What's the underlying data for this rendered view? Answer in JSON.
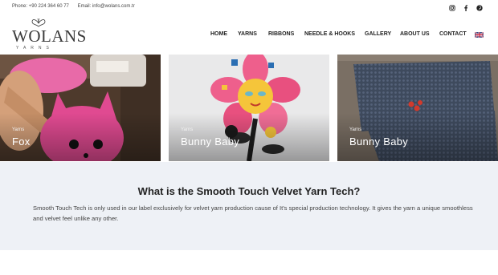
{
  "topbar": {
    "phone": "Phone: +90 224 364 60 77",
    "email": "Email: info@wolans.com.tr",
    "social": [
      "instagram-icon",
      "facebook-icon",
      "pinterest-icon"
    ]
  },
  "brand": {
    "name": "WOLANS",
    "tagline": "YARNS"
  },
  "nav": [
    "HOME",
    "YARNS",
    "RIBBONS",
    "NEEDLE & HOOKS",
    "GALLERY",
    "ABOUT US",
    "CONTACT"
  ],
  "tiles": [
    {
      "category": "Yarns",
      "title": "Fox"
    },
    {
      "category": "Yarns",
      "title": "Bunny Baby"
    },
    {
      "category": "Yarns",
      "title": "Bunny Baby"
    }
  ],
  "info": {
    "heading": "What is the Smooth Touch Velvet Yarn Tech?",
    "body": "Smooth Touch Tech is only used in our label exclusively for velvet yarn production cause of It's special production technology. It gives the yarn a unique smoothless and velvet feel unlike any other."
  },
  "colors": {
    "accent": "#2a2a2a",
    "info_bg": "#eef1f6"
  }
}
